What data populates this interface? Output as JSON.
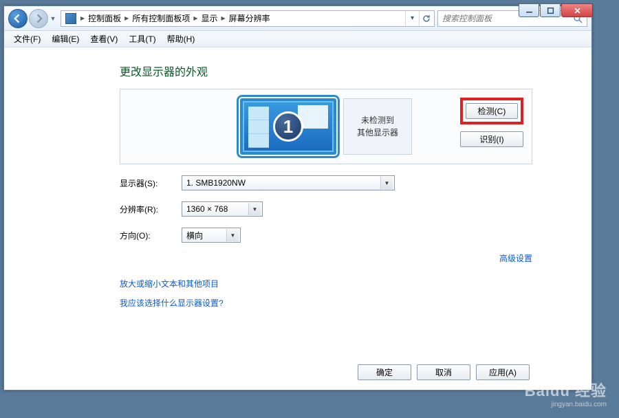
{
  "titlebar": {
    "min": "min",
    "max": "max",
    "close": "close"
  },
  "nav": {
    "crumbs": [
      "控制面板",
      "所有控制面板项",
      "显示",
      "屏幕分辨率"
    ],
    "search_placeholder": "搜索控制面板"
  },
  "menu": {
    "file": "文件(F)",
    "edit": "编辑(E)",
    "view": "查看(V)",
    "tools": "工具(T)",
    "help": "帮助(H)"
  },
  "page": {
    "heading": "更改显示器的外观",
    "monitor_number": "1",
    "no_detect_line1": "未检测到",
    "no_detect_line2": "其他显示器",
    "detect_btn": "检测(C)",
    "identify_btn": "识别(I)",
    "display_label": "显示器(S):",
    "display_value": "1. SMB1920NW",
    "resolution_label": "分辨率(R):",
    "resolution_value": "1360 × 768",
    "orient_label": "方向(O):",
    "orient_value": "横向",
    "adv_link": "高级设置",
    "link1": "放大或缩小文本和其他项目",
    "link2": "我应该选择什么显示器设置?",
    "ok": "确定",
    "cancel": "取消",
    "apply": "应用(A)"
  },
  "watermark": {
    "brand": "Baidu 经验",
    "sub": "jingyan.baidu.com"
  }
}
